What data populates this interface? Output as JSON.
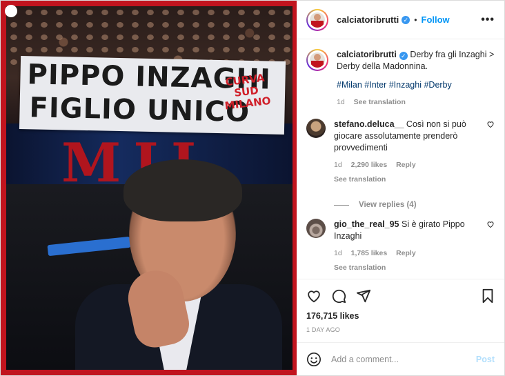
{
  "media": {
    "banner_line1": "PIPPO INZAGHI",
    "banner_line2": "FIGLIO UNICO",
    "banner_stamp": "CURVA SUD MILANO",
    "background_letters": "MIL"
  },
  "header": {
    "username": "calciatoribrutti",
    "verified_icon": "verified-badge-icon",
    "separator": "•",
    "follow_label": "Follow",
    "more_label": "•••"
  },
  "caption": {
    "username": "calciatoribrutti",
    "text": "Derby fra gli Inzaghi > Derby della Madonnina.",
    "hashtags": "#Milan #Inter #Inzaghi #Derby",
    "age": "1d",
    "see_translation": "See translation"
  },
  "comments": [
    {
      "username": "stefano.deluca__",
      "text": "Così non si può giocare assolutamente prenderò provvedimenti",
      "age": "1d",
      "likes": "2,290 likes",
      "reply": "Reply",
      "see_translation": "See translation"
    },
    {
      "username": "gio_the_real_95",
      "text": "Si è girato Pippo Inzaghi",
      "age": "1d",
      "likes": "1,785 likes",
      "reply": "Reply",
      "see_translation": "See translation"
    }
  ],
  "view_replies": "View replies (4)",
  "actions": {
    "likes": "176,715 likes",
    "ago": "1 DAY AGO"
  },
  "add_comment": {
    "placeholder": "Add a comment...",
    "post_label": "Post"
  },
  "colors": {
    "accent": "#0095f6",
    "post_disabled": "#b2dffc",
    "media_frame": "#c1141e"
  }
}
